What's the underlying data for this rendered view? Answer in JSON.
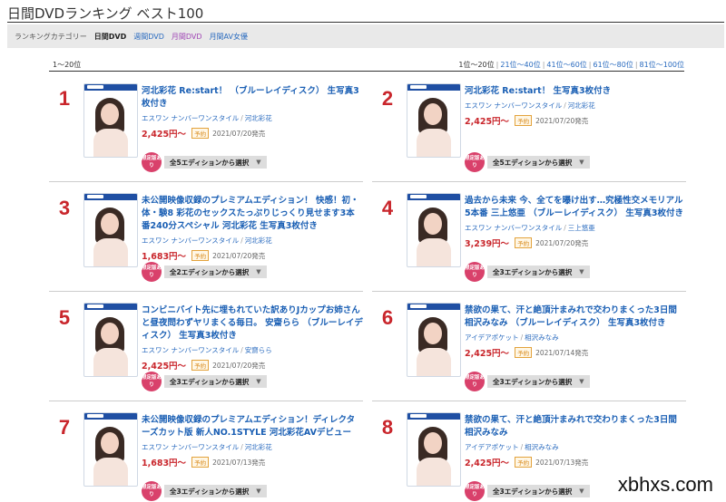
{
  "page": {
    "title": "日間DVDランキング ベスト100"
  },
  "categories": {
    "label": "ランキングカテゴリー",
    "items": [
      {
        "label": "日間DVD",
        "style": "active"
      },
      {
        "label": "週間DVD",
        "style": "link"
      },
      {
        "label": "月間DVD",
        "style": "purple"
      },
      {
        "label": "月間AV女優",
        "style": "link"
      }
    ]
  },
  "range": {
    "label": "1〜20位",
    "pages": [
      "1位〜20位",
      "21位〜40位",
      "41位〜60位",
      "61位〜80位",
      "81位〜100位"
    ]
  },
  "items": [
    {
      "rank": "1",
      "title": "河北彩花 Re:start！ （ブルーレイディスク） 生写真3枚付き",
      "maker": "エスワン ナンバーワンスタイル",
      "actress": "河北彩花",
      "price": "2,425円〜",
      "badge": "予約",
      "release": "2021/07/20発売",
      "limited": "限定版あり",
      "editions": "全5エディションから選択"
    },
    {
      "rank": "2",
      "title": "河北彩花 Re:start！ 生写真3枚付き",
      "maker": "エスワン ナンバーワンスタイル",
      "actress": "河北彩花",
      "price": "2,425円〜",
      "badge": "予約",
      "release": "2021/07/20発売",
      "limited": "限定版あり",
      "editions": "全5エディションから選択"
    },
    {
      "rank": "3",
      "title": "未公開映像収録のプレミアムエディション！ 快感！初・体・験8 彩花のセックスたっぷりじっくり見せます3本番240分スペシャル 河北彩花 生写真3枚付き",
      "maker": "エスワン ナンバーワンスタイル",
      "actress": "河北彩花",
      "price": "1,683円〜",
      "badge": "予約",
      "release": "2021/07/20発売",
      "limited": "限定版あり",
      "editions": "全2エディションから選択"
    },
    {
      "rank": "4",
      "title": "過去から未来 今、全てを曝け出す…究極性交メモリアル5本番 三上悠亜 （ブルーレイディスク） 生写真3枚付き",
      "maker": "エスワン ナンバーワンスタイル",
      "actress": "三上悠亜",
      "price": "3,239円〜",
      "badge": "予約",
      "release": "2021/07/20発売",
      "limited": "限定版あり",
      "editions": "全3エディションから選択"
    },
    {
      "rank": "5",
      "title": "コンビニバイト先に埋もれていた訳ありJカップお姉さんと昼夜問わずヤリまくる毎日。 安齋らら （ブルーレイディスク） 生写真3枚付き",
      "maker": "エスワン ナンバーワンスタイル",
      "actress": "安齋らら",
      "price": "2,425円〜",
      "badge": "予約",
      "release": "2021/07/20発売",
      "limited": "限定版あり",
      "editions": "全3エディションから選択"
    },
    {
      "rank": "6",
      "title": "禁欲の果て、汗と絶頂汁まみれで交わりまくった3日間 相沢みなみ （ブルーレイディスク） 生写真3枚付き",
      "maker": "アイデアポケット",
      "actress": "相沢みなみ",
      "price": "2,425円〜",
      "badge": "予約",
      "release": "2021/07/14発売",
      "limited": "限定版あり",
      "editions": "全3エディションから選択"
    },
    {
      "rank": "7",
      "title": "未公開映像収録のプレミアムエディション！ディレクターズカット版 新人NO.1STYLE 河北彩花AVデビュー",
      "maker": "エスワン ナンバーワンスタイル",
      "actress": "河北彩花",
      "price": "1,683円〜",
      "badge": "予約",
      "release": "2021/07/13発売",
      "limited": "限定版あり",
      "editions": "全3エディションから選択"
    },
    {
      "rank": "8",
      "title": "禁欲の果て、汗と絶頂汁まみれで交わりまくった3日間 相沢みなみ",
      "maker": "アイデアポケット",
      "actress": "相沢みなみ",
      "price": "2,425円〜",
      "badge": "予約",
      "release": "2021/07/13発売",
      "limited": "限定版あり",
      "editions": "全3エディションから選択"
    }
  ],
  "watermark": "xbhxs.com"
}
